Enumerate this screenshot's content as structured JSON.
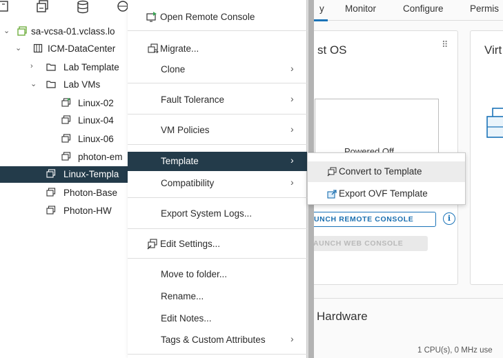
{
  "toolbar_icons": [
    "host-icon",
    "vm-templates-icon",
    "storage-icon",
    "network-icon"
  ],
  "tree": [
    {
      "label": "sa-vcsa-01.vclass.lo",
      "icon": "vcenter-icon",
      "expand": "expanded"
    },
    {
      "label": "ICM-DataCenter",
      "icon": "datacenter-icon",
      "expand": "expanded"
    },
    {
      "label": "Lab Template",
      "icon": "folder-icon",
      "expand": "collapsed"
    },
    {
      "label": "Lab VMs",
      "icon": "folder-icon",
      "expand": "expanded"
    },
    {
      "label": "Linux-02",
      "icon": "vm-icon",
      "expand": "none"
    },
    {
      "label": "Linux-04",
      "icon": "vm-icon",
      "expand": "none"
    },
    {
      "label": "Linux-06",
      "icon": "vm-icon",
      "expand": "none"
    },
    {
      "label": "photon-em",
      "icon": "vm-icon",
      "expand": "none"
    },
    {
      "label": "Linux-Templa",
      "icon": "vm-icon",
      "expand": "none",
      "selected": true
    },
    {
      "label": "Photon-Base",
      "icon": "vm-icon",
      "expand": "none"
    },
    {
      "label": "Photon-HW",
      "icon": "vm-icon",
      "expand": "none"
    }
  ],
  "context_menu": {
    "items": [
      {
        "label": "Open Remote Console",
        "icon": "remote-console-icon"
      },
      {
        "label": "Migrate...",
        "icon": "migrate-icon"
      },
      {
        "label": "Clone",
        "submenu": true
      },
      {
        "label": "Fault Tolerance",
        "submenu": true
      },
      {
        "label": "VM Policies",
        "submenu": true
      },
      {
        "label": "Template",
        "submenu": true,
        "active": true
      },
      {
        "label": "Compatibility",
        "submenu": true
      },
      {
        "label": "Export System Logs..."
      },
      {
        "label": "Edit Settings...",
        "icon": "edit-settings-icon"
      },
      {
        "label": "Move to folder..."
      },
      {
        "label": "Rename..."
      },
      {
        "label": "Edit Notes..."
      },
      {
        "label": "Tags & Custom Attributes",
        "submenu": true
      }
    ],
    "arrow": "›"
  },
  "submenu": {
    "items": [
      {
        "label": "Convert to Template",
        "icon": "convert-template-icon",
        "hover": true
      },
      {
        "label": "Export OVF Template",
        "icon": "export-ovf-icon"
      }
    ]
  },
  "main": {
    "tabs": [
      "y",
      "Monitor",
      "Configure",
      "Permis"
    ],
    "card_guest_os": {
      "title": "st OS",
      "power_state": "Powered Off",
      "launch_remote": "UNCH REMOTE CONSOLE",
      "launch_web": "AUNCH WEB CONSOLE"
    },
    "card_virtual": {
      "title": "Virt"
    },
    "hardware_title": "Hardware",
    "cpu_summary": "1 CPU(s), 0 MHz use"
  },
  "colors": {
    "selected_bg": "#233b4a",
    "accent": "#1a73b8",
    "vcenter_green": "#6fae3f"
  }
}
